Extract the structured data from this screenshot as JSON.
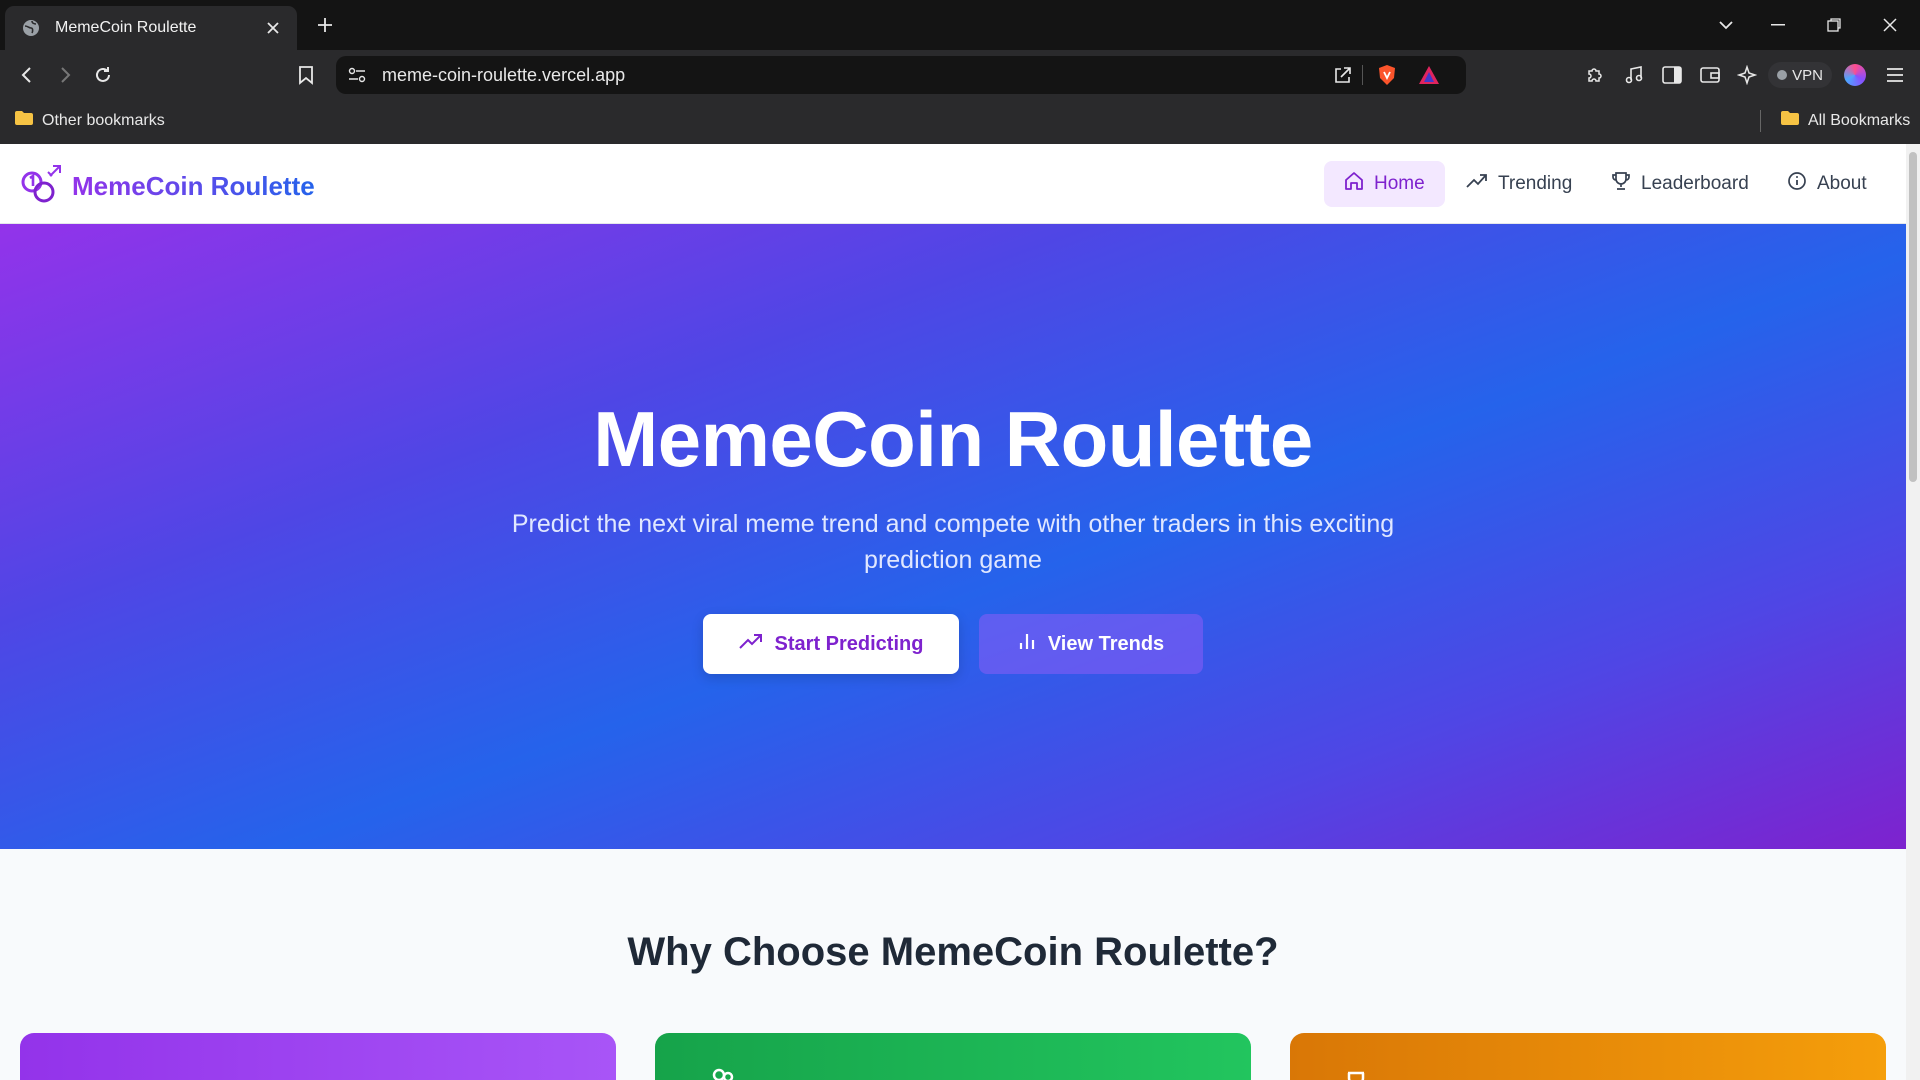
{
  "browser": {
    "tab": {
      "title": "MemeCoin Roulette",
      "favicon": "globe-icon"
    },
    "url": "meme-coin-roulette.vercel.app",
    "vpn_label": "VPN",
    "bookmarks": {
      "other": "Other bookmarks",
      "all": "All Bookmarks"
    }
  },
  "app": {
    "brand": "MemeCoin Roulette",
    "nav": [
      {
        "label": "Home",
        "icon": "home-icon",
        "active": true
      },
      {
        "label": "Trending",
        "icon": "trending-up-icon",
        "active": false
      },
      {
        "label": "Leaderboard",
        "icon": "trophy-icon",
        "active": false
      },
      {
        "label": "About",
        "icon": "info-icon",
        "active": false
      }
    ],
    "hero": {
      "title": "MemeCoin Roulette",
      "subtitle": "Predict the next viral meme trend and compete with other traders in this exciting prediction game",
      "primary_button": "Start Predicting",
      "secondary_button": "View Trends"
    },
    "features": {
      "title": "Why Choose MemeCoin Roulette?"
    }
  },
  "colors": {
    "accent_purple": "#9333ea",
    "accent_blue": "#2563eb",
    "card_purple": "#9333ea",
    "card_green": "#16a34a",
    "card_orange": "#d97706"
  }
}
